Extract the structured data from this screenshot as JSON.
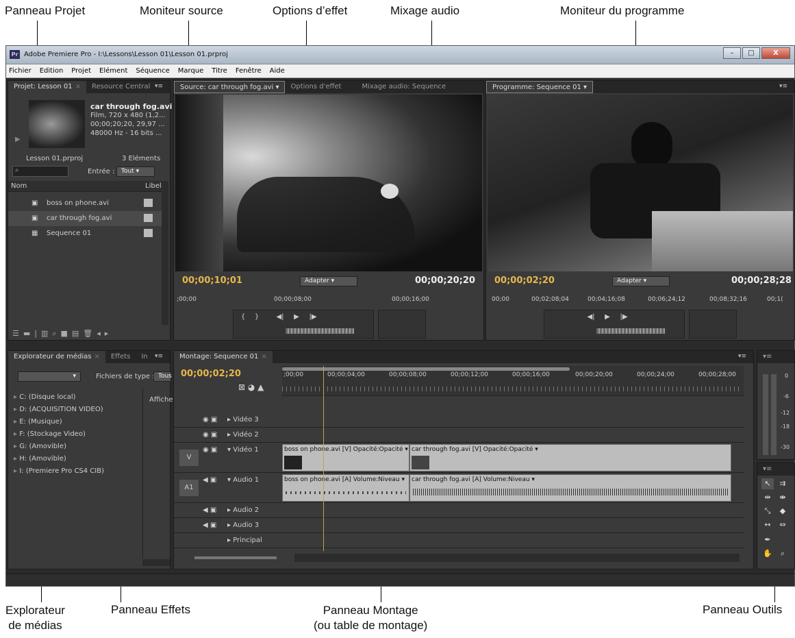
{
  "callouts": {
    "project": "Panneau Projet",
    "source": "Moniteur source",
    "effect_options": "Options d’effet",
    "audio_mix": "Mixage audio",
    "program": "Moniteur du programme",
    "media_browser_1": "Explorateur",
    "media_browser_2": "de médias",
    "effects": "Panneau Effets",
    "timeline_1": "Panneau Montage",
    "timeline_2": "(ou table de montage)",
    "tools": "Panneau Outils"
  },
  "window": {
    "logo": "Pr",
    "title": "Adobe Premiere Pro - I:\\Lessons\\Lesson 01\\Lesson 01.prproj",
    "minimize": "–",
    "maximize": "□",
    "close": "X"
  },
  "menu": [
    "Fichier",
    "Edition",
    "Projet",
    "Elément",
    "Séquence",
    "Marque",
    "Titre",
    "Fenêtre",
    "Aide"
  ],
  "project_panel": {
    "tabs": [
      "Projet: Lesson 01",
      "Resource Central"
    ],
    "clip_name": "car through fog.avi",
    "clip_info": [
      "Film, 720 x 480 (1,2...",
      "00;00;20;20, 29,97 ...",
      "48000 Hz - 16 bits ..."
    ],
    "project_file": "Lesson 01.prproj",
    "item_count": "3 Eléments",
    "entry_label": "Entrée :",
    "entry_value": "Tout",
    "col_name": "Nom",
    "col_label": "Libel",
    "items": [
      "boss on phone.avi",
      "car through fog.avi",
      "Sequence 01"
    ]
  },
  "source_panel": {
    "tabs": [
      "Source: car through fog.avi",
      "Options d'effet",
      "Mixage audio: Sequence"
    ],
    "timecode_left": "00;00;10;01",
    "fit": "Adapter",
    "timecode_right": "00;00;20;20",
    "ruler": [
      ";00;00",
      "00;00;08;00",
      "00;00;16;00"
    ]
  },
  "program_panel": {
    "tab": "Programme: Sequence 01",
    "timecode_left": "00;00;02;20",
    "fit": "Adapter",
    "timecode_right": "00;00;28;28",
    "ruler": [
      "00;00",
      "00;02;08;04",
      "00;04;16;08",
      "00;06;24;12",
      "00;08;32;16",
      "00;1("
    ]
  },
  "media_panel": {
    "tabs": [
      "Explorateur de médias",
      "Effets",
      "In"
    ],
    "file_type_label": "Fichiers de type :",
    "file_type_value": "Tous",
    "display_label": "Affiche",
    "drives": [
      "C: (Disque local)",
      "D: (ACQUISITION VIDEO)",
      "E: (Musique)",
      "F: (Stockage Video)",
      "G: (Amovible)",
      "H: (Amovible)",
      "I: (Premiere Pro CS4 CIB)"
    ]
  },
  "timeline_panel": {
    "tab": "Montage: Sequence 01",
    "timecode": "00;00;02;20",
    "ruler": [
      ";00;00",
      "00;00;04;00",
      "00;00;08;00",
      "00;00;12;00",
      "00;00;16;00",
      "00;00;20;00",
      "00;00;24;00",
      "00;00;28;00"
    ],
    "tracks": [
      "Vidéo 3",
      "Vidéo 2",
      "Vidéo 1",
      "Audio 1",
      "Audio 2",
      "Audio 3",
      "Principal"
    ],
    "v_label": "V",
    "a_label": "A1",
    "clips_video": [
      "boss on phone.avi [V]  Opacité:Opacité ▾",
      "car through fog.avi [V]  Opacité:Opacité ▾"
    ],
    "clips_audio": [
      "boss on phone.avi [A]  Volume:Niveau ▾",
      "car through fog.avi [A]  Volume:Niveau ▾"
    ]
  },
  "audio_meter": {
    "ticks": [
      "0",
      "-6",
      "-12",
      "-18",
      "-30"
    ]
  },
  "colors": {
    "timecode": "#e8b74a",
    "panel": "#3a3a3a",
    "clip": "#bdbdbd"
  }
}
